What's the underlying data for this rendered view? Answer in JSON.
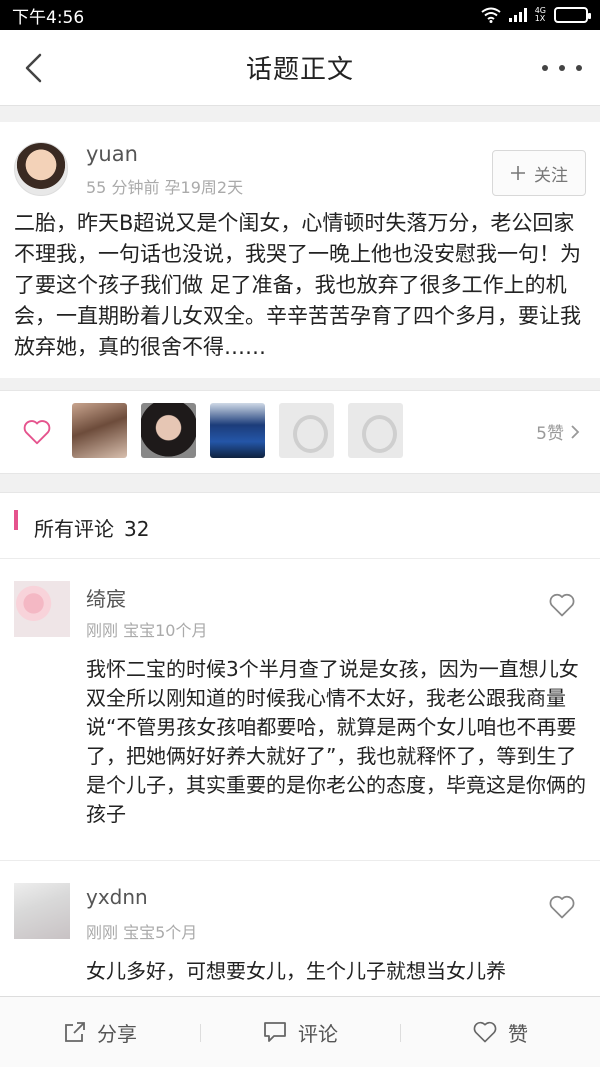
{
  "status_bar": {
    "time": "下午4:56",
    "network_top": "4G",
    "network_bottom": "1X"
  },
  "nav": {
    "title": "话题正文"
  },
  "post": {
    "author": "yuan",
    "meta": "55 分钟前 孕19周2天",
    "follow_label": "关注",
    "content": "二胎，昨天B超说又是个闺女，心情顿时失落万分，老公回家不理我，一句话也没说，我哭了一晚上他也没安慰我一句！为了要这个孩子我们做 足了准备，我也放弃了很多工作上的机会，一直期盼着儿女双全。辛辛苦苦孕育了四个多月，要让我放弃她，真的很舍不得……"
  },
  "likes": {
    "count_label": "5赞"
  },
  "comments_header": {
    "label": "所有评论",
    "count": "32"
  },
  "comments": [
    {
      "name": "绮宸",
      "meta": "刚刚 宝宝10个月",
      "text": "我怀二宝的时候3个半月查了说是女孩，因为一直想儿女双全所以刚知道的时候我心情不太好，我老公跟我商量说“不管男孩女孩咱都要哈，就算是两个女儿咱也不再要了，把她俩好好养大就好了”，我也就释怀了，等到生了是个儿子，其实重要的是你老公的态度，毕竟这是你俩的孩子"
    },
    {
      "name": "yxdnn",
      "meta": "刚刚 宝宝5个月",
      "text": "女儿多好，可想要女儿，生个儿子就想当女儿养"
    }
  ],
  "footer": {
    "share": "分享",
    "comment": "评论",
    "like": "赞"
  },
  "colors": {
    "accent": "#e5538d",
    "heart": "#e5538d"
  }
}
